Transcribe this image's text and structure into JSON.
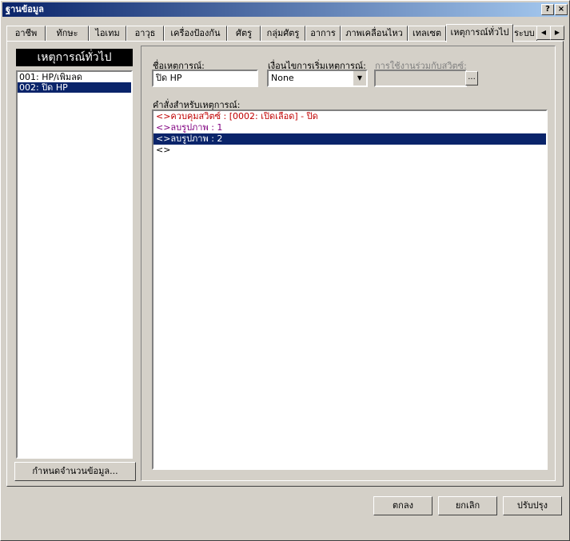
{
  "window": {
    "title": "ฐานข้อมูล",
    "help_label": "?",
    "close_label": "×"
  },
  "tabs": [
    {
      "label": "อาชีพ"
    },
    {
      "label": "ทักษะ"
    },
    {
      "label": "ไอเทม"
    },
    {
      "label": "อาวุธ"
    },
    {
      "label": "เครื่องป้องกัน"
    },
    {
      "label": "ศัตรู"
    },
    {
      "label": "กลุ่มศัตรู"
    },
    {
      "label": "อาการ"
    },
    {
      "label": "ภาพเคลื่อนไหว"
    },
    {
      "label": "เทลเซต"
    },
    {
      "label": "เหตุการณ์ทั่วไป"
    },
    {
      "label": "ระบบ"
    }
  ],
  "active_tab": "เหตุการณ์ทั่วไป",
  "tab_scroll": {
    "left": "◀",
    "right": "▶"
  },
  "left_panel": {
    "header": "เหตุการณ์ทั่วไป",
    "items": [
      {
        "label": "001: HP/เพิ่มลด"
      },
      {
        "label": "002: ปิด HP"
      }
    ],
    "selected_index": 1,
    "set_count_button": "กำหนดจำนวนข้อมูล..."
  },
  "editor": {
    "name_label": "ชื่อเหตุการณ์:",
    "name_value": "ปิด HP",
    "trigger_label": "เงื่อนไขการเริ่มเหตุการณ์:",
    "trigger_value": "None",
    "trigger_arrow": "▼",
    "switch_label": "การใช้งานร่วมกับสวิตซ์:",
    "switch_button": "...",
    "commands_label": "คำสั่งสำหรับเหตุการณ์:",
    "commands": [
      {
        "text": "<>ควบคุมสวิตซ์ : [0002: เปิดเลือด] - ปิด",
        "color": "#c00000"
      },
      {
        "text": "<>ลบรูปภาพ : 1",
        "color": "#800080"
      },
      {
        "text": "<>ลบรูปภาพ : 2",
        "color": "#800080"
      },
      {
        "text": "<>",
        "color": "#000000"
      }
    ],
    "selected_command_index": 2
  },
  "footer": {
    "ok": "ตกลง",
    "cancel": "ยกเลิก",
    "apply": "ปรับปรุง"
  }
}
